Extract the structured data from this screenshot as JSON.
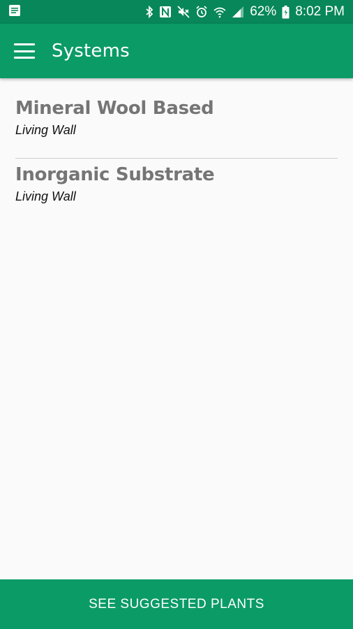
{
  "status_bar": {
    "battery": "62%",
    "time": "8:02 PM",
    "icons": [
      "notification-icon",
      "bluetooth-icon",
      "nfc-icon",
      "mute-icon",
      "alarm-icon",
      "wifi-icon",
      "signal-icon",
      "battery-icon"
    ]
  },
  "app_bar": {
    "title": "Systems",
    "menu_icon": "menu-icon"
  },
  "systems": [
    {
      "name": "Mineral Wool Based",
      "type": "Living Wall"
    },
    {
      "name": "Inorganic Substrate",
      "type": "Living Wall"
    }
  ],
  "bottom_button": {
    "label": "SEE SUGGESTED PLANTS"
  },
  "colors": {
    "status_bar": "#07875a",
    "app_bar": "#0b9b67",
    "title_text": "#757575"
  }
}
